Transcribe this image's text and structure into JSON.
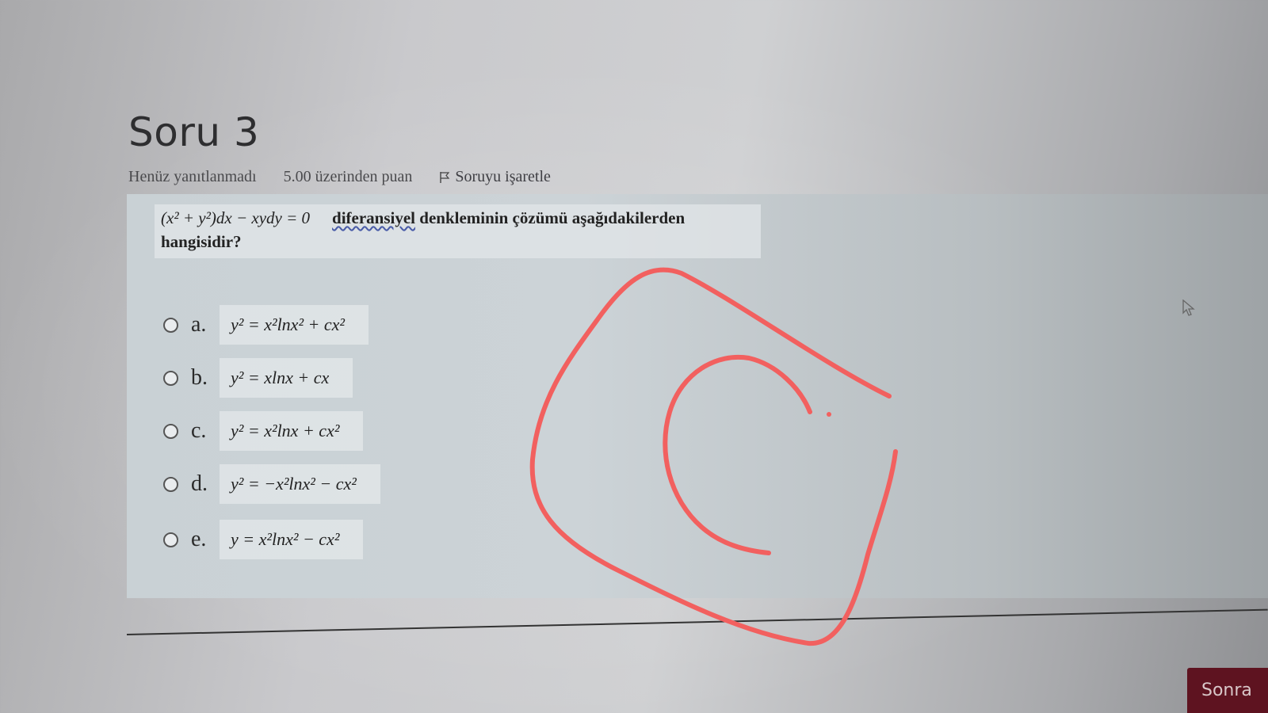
{
  "question": {
    "title": "Soru 3",
    "status": "Henüz yanıtlanmadı",
    "points": "5.00 üzerinden puan",
    "flag_label": "Soruyu işaretle",
    "flag_icon": "flag-icon",
    "equation": "(x² + y²)dx − xydy = 0",
    "prompt_underlined": "diferansiyel",
    "prompt_rest": "denkleminin çözümü aşağıdakilerden",
    "prompt_line2": "hangisidir?"
  },
  "options": [
    {
      "letter": "a.",
      "formula": "y² = x²lnx² + cx²"
    },
    {
      "letter": "b.",
      "formula": "y² = xlnx + cx"
    },
    {
      "letter": "c.",
      "formula": "y² = x²lnx + cx²"
    },
    {
      "letter": "d.",
      "formula": "y² = −x²lnx² − cx²"
    },
    {
      "letter": "e.",
      "formula": "y = x²lnx² − cx²"
    }
  ],
  "navigation": {
    "next_label": "Sonra"
  },
  "annotation": {
    "color": "#f2605f",
    "icon": "handwritten-c-circle-annotation"
  }
}
